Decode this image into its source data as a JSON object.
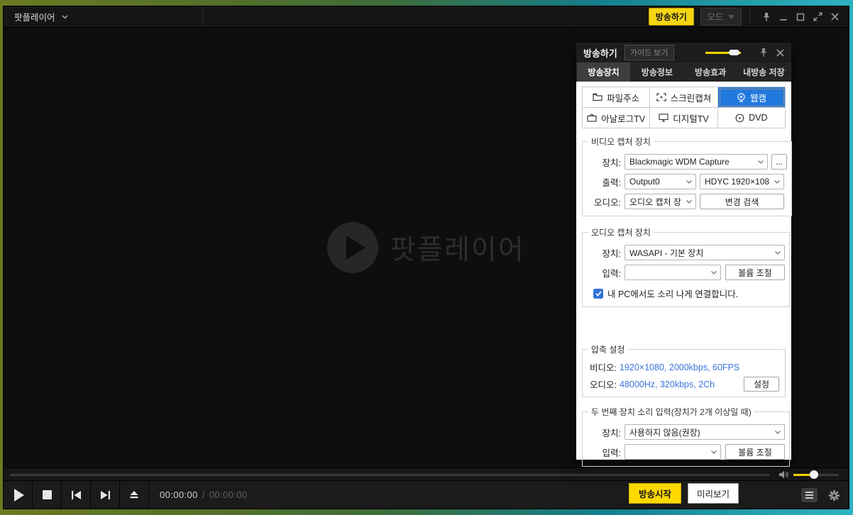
{
  "colors": {
    "accent_yellow": "#f5d512",
    "selected_blue": "#2079dd",
    "link_blue": "#3e74da",
    "checkbox_blue": "#3273d9"
  },
  "titlebar": {
    "app_title": "팟플레이어",
    "broadcast_button": "방송하기",
    "mode_button": "모드"
  },
  "watermark": {
    "label": "팟플레이어"
  },
  "transport": {
    "time_current": "00:00:00",
    "time_separator": "/",
    "time_total": "00:00:00"
  },
  "dialog": {
    "title": "방송하기",
    "guide_button": "가이드 보기",
    "tabs": [
      {
        "label": "방송장치",
        "active": true
      },
      {
        "label": "방송정보",
        "active": false
      },
      {
        "label": "방송효과",
        "active": false
      },
      {
        "label": "내방송 저장",
        "active": false
      }
    ],
    "sources": [
      {
        "label": "파일주소",
        "selected": false
      },
      {
        "label": "스크린캡쳐",
        "selected": false
      },
      {
        "label": "웹캠",
        "selected": true
      },
      {
        "label": "아날로그TV",
        "selected": false
      },
      {
        "label": "디지털TV",
        "selected": false
      },
      {
        "label": "DVD",
        "selected": false
      }
    ],
    "video_capture": {
      "legend": "비디오 캡처 장치",
      "device_label": "장치:",
      "device_value": "Blackmagic WDM Capture",
      "browse_button": "...",
      "output_label": "출력:",
      "output_value": "Output0",
      "format_value": "HDYC 1920×108",
      "audio_label": "오디오:",
      "audio_value": "오디오 캡처 장",
      "rescan_button": "변경 검색"
    },
    "audio_capture": {
      "legend": "오디오 캡처 장치",
      "device_label": "장치:",
      "device_value": "WASAPI - 기본 장치",
      "input_label": "입력:",
      "input_value": "",
      "volume_button": "볼륨 조절",
      "loopback_checkbox": "내 PC에서도 소리 나게 연결합니다.",
      "loopback_checked": true
    },
    "compression": {
      "legend": "압축 설정",
      "video_label": "비디오:",
      "video_value": "1920×1080, 2000kbps, 60FPS",
      "audio_label": "오디오:",
      "audio_value": "48000Hz, 320kbps, 2Ch",
      "settings_button": "설정"
    },
    "second_device": {
      "legend": "두 번째 장치 소리 입력(장치가 2개 이상일 때)",
      "device_label": "장치:",
      "device_value": "사용하지 않음(권장)",
      "input_label": "입력:",
      "input_value": "",
      "volume_button": "볼륨 조절"
    },
    "footer": {
      "start_button": "방송시작",
      "preview_button": "미리보기"
    }
  }
}
